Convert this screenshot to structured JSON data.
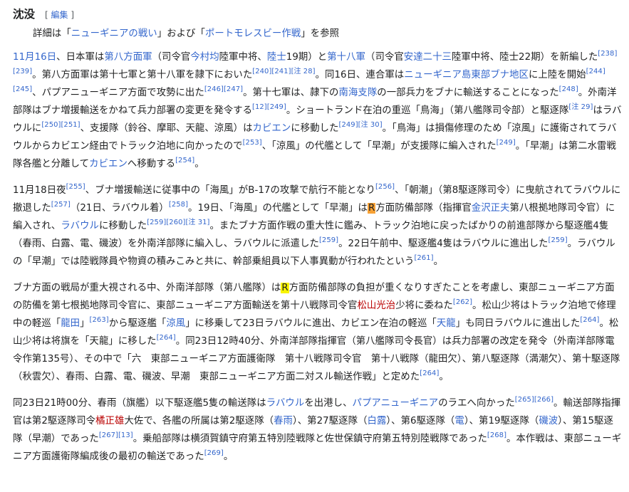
{
  "heading": {
    "title": "沈没",
    "edit_open": "[",
    "edit_label": "編集",
    "edit_close": "]"
  },
  "hatnote": [
    {
      "t": "t",
      "v": "詳細は「"
    },
    {
      "t": "a",
      "v": "ニューギニアの戦い"
    },
    {
      "t": "t",
      "v": "」および「"
    },
    {
      "t": "a",
      "v": "ポートモレスビー作戦"
    },
    {
      "t": "t",
      "v": "」を参照"
    }
  ],
  "paragraphs": [
    [
      {
        "t": "a",
        "v": "11月16日"
      },
      {
        "t": "t",
        "v": "、日本軍は"
      },
      {
        "t": "a",
        "v": "第八方面軍"
      },
      {
        "t": "t",
        "v": "（司令官"
      },
      {
        "t": "a",
        "v": "今村均"
      },
      {
        "t": "t",
        "v": "陸軍中将、"
      },
      {
        "t": "a",
        "v": "陸士"
      },
      {
        "t": "t",
        "v": "19期）と"
      },
      {
        "t": "a",
        "v": "第十八軍"
      },
      {
        "t": "t",
        "v": "（司令官"
      },
      {
        "t": "a",
        "v": "安達二十三"
      },
      {
        "t": "t",
        "v": "陸軍中将、陸士22期）を新編した"
      },
      {
        "t": "r",
        "v": "[238]"
      },
      {
        "t": "r",
        "v": "[239]"
      },
      {
        "t": "t",
        "v": "。第八方面軍は第十七軍と第十八軍を隷下においた"
      },
      {
        "t": "r",
        "v": "[240]"
      },
      {
        "t": "r",
        "v": "[241]"
      },
      {
        "t": "r",
        "v": "[注 28]"
      },
      {
        "t": "t",
        "v": "。同16日、連合軍は"
      },
      {
        "t": "a",
        "v": "ニューギニア島東部ブナ地区"
      },
      {
        "t": "t",
        "v": "に上陸を開始"
      },
      {
        "t": "r",
        "v": "[244]"
      },
      {
        "t": "r",
        "v": "[245]"
      },
      {
        "t": "t",
        "v": "、パプアニューギニア方面で攻勢に出た"
      },
      {
        "t": "r",
        "v": "[246]"
      },
      {
        "t": "r",
        "v": "[247]"
      },
      {
        "t": "t",
        "v": "。第十七軍は、隷下の"
      },
      {
        "t": "a",
        "v": "南海支隊"
      },
      {
        "t": "t",
        "v": "の一部兵力をブナに輸送することになった"
      },
      {
        "t": "r",
        "v": "[248]"
      },
      {
        "t": "t",
        "v": "。外南洋部隊はブナ増援輸送をかねて兵力部署の変更を発令する"
      },
      {
        "t": "r",
        "v": "[12]"
      },
      {
        "t": "r",
        "v": "[249]"
      },
      {
        "t": "t",
        "v": "。ショートランド在泊の重巡「鳥海」（第八艦隊司令部）と駆逐隊"
      },
      {
        "t": "r",
        "v": "[注 29]"
      },
      {
        "t": "t",
        "v": "はラバウルに"
      },
      {
        "t": "r",
        "v": "[250]"
      },
      {
        "t": "r",
        "v": "[251]"
      },
      {
        "t": "t",
        "v": "、支援隊（鈴谷、摩耶、天龍、涼風）は"
      },
      {
        "t": "a",
        "v": "カビエン"
      },
      {
        "t": "t",
        "v": "に移動した"
      },
      {
        "t": "r",
        "v": "[249]"
      },
      {
        "t": "r",
        "v": "[注 30]"
      },
      {
        "t": "t",
        "v": "。「鳥海」は損傷修理のため「涼風」に護衛されてラバウルからカビエン経由でトラック泊地に向かったので"
      },
      {
        "t": "r",
        "v": "[253]"
      },
      {
        "t": "t",
        "v": "、「涼風」の代艦として「早潮」が支援隊に編入された"
      },
      {
        "t": "r",
        "v": "[249]"
      },
      {
        "t": "t",
        "v": "。「早潮」は第二水雷戦隊各艦と分離して"
      },
      {
        "t": "a",
        "v": "カビエン"
      },
      {
        "t": "t",
        "v": "へ移動する"
      },
      {
        "t": "r",
        "v": "[254]"
      },
      {
        "t": "t",
        "v": "。"
      }
    ],
    [
      {
        "t": "t",
        "v": "11月18日夜"
      },
      {
        "t": "r",
        "v": "[255]"
      },
      {
        "t": "t",
        "v": "、ブナ増援輸送に従事中の「海風」がB-17の攻撃で航行不能となり"
      },
      {
        "t": "r",
        "v": "[256]"
      },
      {
        "t": "t",
        "v": "、「朝潮」（第8駆逐隊司令）に曳航されてラバウルに撤退した"
      },
      {
        "t": "r",
        "v": "[257]"
      },
      {
        "t": "t",
        "v": "（21日、ラバウル着）"
      },
      {
        "t": "r",
        "v": "[258]"
      },
      {
        "t": "t",
        "v": "。19日、「海風」の代艦として「早潮」は"
      },
      {
        "t": "ho",
        "v": "R"
      },
      {
        "t": "t",
        "v": "方面防備部隊（指揮官"
      },
      {
        "t": "a",
        "v": "金沢正夫"
      },
      {
        "t": "t",
        "v": "第八根拠地隊司令官）に編入され、"
      },
      {
        "t": "a",
        "v": "ラバウル"
      },
      {
        "t": "t",
        "v": "に移動した"
      },
      {
        "t": "r",
        "v": "[259]"
      },
      {
        "t": "r",
        "v": "[260]"
      },
      {
        "t": "r",
        "v": "[注 31]"
      },
      {
        "t": "t",
        "v": "。またブナ方面作戦の重大性に鑑み、トラック泊地に戻ったばかりの前進部隊から駆逐艦4隻（春雨、白露、電、磯波）を外南洋部隊に編入し、ラバウルに派遣した"
      },
      {
        "t": "r",
        "v": "[259]"
      },
      {
        "t": "t",
        "v": "。22日午前中、駆逐艦4隻はラバウルに進出した"
      },
      {
        "t": "r",
        "v": "[259]"
      },
      {
        "t": "t",
        "v": "。ラバウルの「早潮」では陸戦隊員や物資の積みこみと共に、幹部乗組員以下人事異動が行われたという"
      },
      {
        "t": "r",
        "v": "[261]"
      },
      {
        "t": "t",
        "v": "。"
      }
    ],
    [
      {
        "t": "t",
        "v": "ブナ方面の戦局が重大視される中、外南洋部隊（第八艦隊）は"
      },
      {
        "t": "hy",
        "v": "R"
      },
      {
        "t": "t",
        "v": "方面防備部隊の負担が重くなりすぎたことを考慮し、東部ニューギニア方面の防備を第七根拠地隊司令官に、東部ニューギニア方面輸送を第十八戦隊司令官"
      },
      {
        "t": "ar",
        "v": "松山光治"
      },
      {
        "t": "t",
        "v": "少将に委ねた"
      },
      {
        "t": "r",
        "v": "[262]"
      },
      {
        "t": "t",
        "v": "。松山少将はトラック泊地で修理中の軽巡「"
      },
      {
        "t": "a",
        "v": "龍田"
      },
      {
        "t": "t",
        "v": "」"
      },
      {
        "t": "r",
        "v": "[263]"
      },
      {
        "t": "t",
        "v": "から駆逐艦「"
      },
      {
        "t": "a",
        "v": "涼風"
      },
      {
        "t": "t",
        "v": "」に移乗して23日ラバウルに進出、カビエン在泊の軽巡「"
      },
      {
        "t": "a",
        "v": "天龍"
      },
      {
        "t": "t",
        "v": "」も同日ラバウルに進出した"
      },
      {
        "t": "r",
        "v": "[264]"
      },
      {
        "t": "t",
        "v": "。松山少将は将旗を「天龍」に移した"
      },
      {
        "t": "r",
        "v": "[264]"
      },
      {
        "t": "t",
        "v": "。同23日12時40分、外南洋部隊指揮官（第八艦隊司令長官）は兵力部署の改定を発令（外南洋部隊電令作第135号）、その中で「六　東部ニューギニア方面護衛隊　第十八戦隊司令官　第十八戦隊（龍田欠）、第八駆逐隊（満潮欠）、第十駆逐隊（秋雲欠）、春雨、白露、電、磯波、早潮　東部ニューギニア方面二対スル輸送作戦」と定めた"
      },
      {
        "t": "r",
        "v": "[264]"
      },
      {
        "t": "t",
        "v": "。"
      }
    ],
    [
      {
        "t": "t",
        "v": "同23日21時00分、春雨（旗艦）以下駆逐艦5隻の輸送隊は"
      },
      {
        "t": "a",
        "v": "ラバウル"
      },
      {
        "t": "t",
        "v": "を出港し、"
      },
      {
        "t": "a",
        "v": "パプアニューギニア"
      },
      {
        "t": "t",
        "v": "のラエへ向かった"
      },
      {
        "t": "r",
        "v": "[265]"
      },
      {
        "t": "r",
        "v": "[266]"
      },
      {
        "t": "t",
        "v": "。輸送部隊指揮官は第2駆逐隊司令"
      },
      {
        "t": "ar",
        "v": "橘正雄"
      },
      {
        "t": "t",
        "v": "大佐で、各艦の所属は第2駆逐隊（"
      },
      {
        "t": "a",
        "v": "春雨"
      },
      {
        "t": "t",
        "v": "）、第27駆逐隊（"
      },
      {
        "t": "a",
        "v": "白露"
      },
      {
        "t": "t",
        "v": "）、第6駆逐隊（"
      },
      {
        "t": "a",
        "v": "電"
      },
      {
        "t": "t",
        "v": "）、第19駆逐隊（"
      },
      {
        "t": "a",
        "v": "磯波"
      },
      {
        "t": "t",
        "v": "）、第15駆逐隊（早潮）であった"
      },
      {
        "t": "r",
        "v": "[267]"
      },
      {
        "t": "r",
        "v": "[13]"
      },
      {
        "t": "t",
        "v": "。乗船部隊は横須賀鎮守府第五特別陸戦隊と佐世保鎮守府第五特別陸戦隊であった"
      },
      {
        "t": "r",
        "v": "[268]"
      },
      {
        "t": "t",
        "v": "。本作戦は、東部ニューギニア方面護衛隊編成後の最初の輸送であった"
      },
      {
        "t": "r",
        "v": "[269]"
      },
      {
        "t": "t",
        "v": "。"
      }
    ]
  ],
  "colors": {
    "link": "#3366cc",
    "redlink": "#ba0000",
    "text": "#202122",
    "highlight_orange": "#f7a134",
    "highlight_yellow": "#f8f400"
  }
}
